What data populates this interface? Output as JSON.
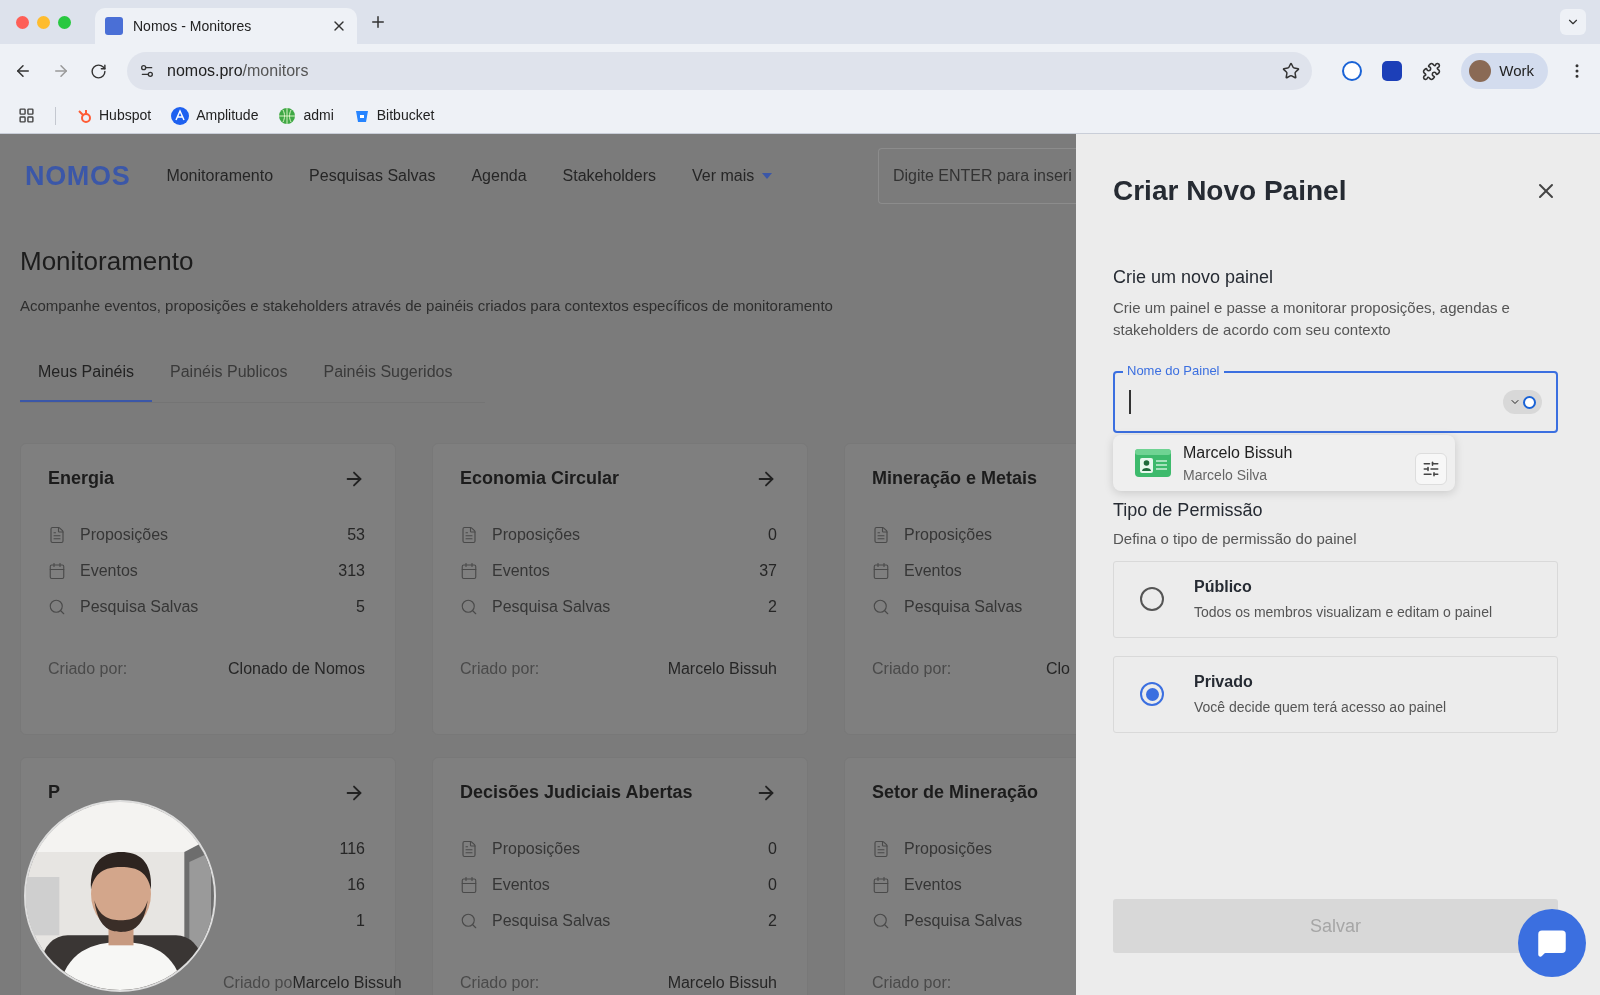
{
  "browser": {
    "tab_title": "Nomos - Monitores",
    "url_host": "nomos.pro",
    "url_path": "/monitors",
    "profile": "Work",
    "bookmarks": [
      {
        "label": "Hubspot",
        "kind": "hubspot"
      },
      {
        "label": "Amplitude",
        "kind": "amplitude"
      },
      {
        "label": "admi",
        "kind": "globe"
      },
      {
        "label": "Bitbucket",
        "kind": "bucket"
      }
    ]
  },
  "nav": {
    "logo": "NOMOS",
    "items": [
      "Monitoramento",
      "Pesquisas Salvas",
      "Agenda",
      "Stakeholders"
    ],
    "more": "Ver mais",
    "search_placeholder": "Digite ENTER para inseri"
  },
  "page": {
    "title": "Monitoramento",
    "subtitle": "Acompanhe eventos, proposições e stakeholders através de painéis criados para contextos específicos de monitoramento",
    "tabs": [
      {
        "label": "Meus Painéis",
        "selected": true
      },
      {
        "label": "Painéis Publicos",
        "selected": false
      },
      {
        "label": "Painéis Sugeridos",
        "selected": false
      }
    ]
  },
  "cards": [
    {
      "title": "Energia",
      "clipped": false,
      "stats": [
        {
          "kind": "proposals",
          "label": "Proposições",
          "value": "53"
        },
        {
          "kind": "events",
          "label": "Eventos",
          "value": "313"
        },
        {
          "kind": "searches",
          "label": "Pesquisa Salvas",
          "value": "5"
        }
      ],
      "creator_label": "Criado por:",
      "creator": "Clonado de Nomos"
    },
    {
      "title": "Economia Circular",
      "clipped": false,
      "stats": [
        {
          "kind": "proposals",
          "label": "Proposições",
          "value": "0"
        },
        {
          "kind": "events",
          "label": "Eventos",
          "value": "37"
        },
        {
          "kind": "searches",
          "label": "Pesquisa Salvas",
          "value": "2"
        }
      ],
      "creator_label": "Criado por:",
      "creator": "Marcelo Bissuh"
    },
    {
      "title": "Mineração e Metais",
      "clipped": true,
      "stats": [
        {
          "kind": "proposals",
          "label": "Proposições"
        },
        {
          "kind": "events",
          "label": "Eventos"
        },
        {
          "kind": "searches",
          "label": "Pesquisa Salvas"
        }
      ],
      "creator_label": "Criado por:",
      "creator": "Clo"
    },
    {
      "title": "P",
      "clipped": false,
      "covered": true,
      "stats": [
        {
          "value": "116"
        },
        {
          "value": "16"
        },
        {
          "value": "1"
        }
      ],
      "creator_label": "Criado po",
      "creator": "Marcelo Bissuh"
    },
    {
      "title": "Decisões Judiciais Abertas",
      "clipped": false,
      "stats": [
        {
          "kind": "proposals",
          "label": "Proposições",
          "value": "0"
        },
        {
          "kind": "events",
          "label": "Eventos",
          "value": "0"
        },
        {
          "kind": "searches",
          "label": "Pesquisa Salvas",
          "value": "2"
        }
      ],
      "creator_label": "Criado por:",
      "creator": "Marcelo Bissuh"
    },
    {
      "title": "Setor de Mineração",
      "clipped": true,
      "stats": [
        {
          "kind": "proposals",
          "label": "Proposições"
        },
        {
          "kind": "events",
          "label": "Eventos"
        },
        {
          "kind": "searches",
          "label": "Pesquisa Salvas"
        }
      ],
      "creator_label": "Criado por:"
    }
  ],
  "panel": {
    "title": "Criar Novo Painel",
    "section_title": "Crie um novo painel",
    "section_text": "Crie um painel e passe a monitorar proposições, agendas e stakeholders de acordo com seu contexto",
    "field": {
      "label": "Nome do Painel",
      "focused": true
    },
    "autofill": {
      "name": "Marcelo Bissuh",
      "detail": "Marcelo Silva"
    },
    "permission_title": "Tipo de Permissão",
    "permission_text": "Defina o tipo de permissão do painel",
    "options": [
      {
        "label": "Público",
        "description": "Todos os membros visualizam e editam o painel",
        "selected": false
      },
      {
        "label": "Privado",
        "description": "Você decide quem terá acesso ao painel",
        "selected": true
      }
    ],
    "save": {
      "label": "Salvar",
      "disabled": true
    }
  }
}
